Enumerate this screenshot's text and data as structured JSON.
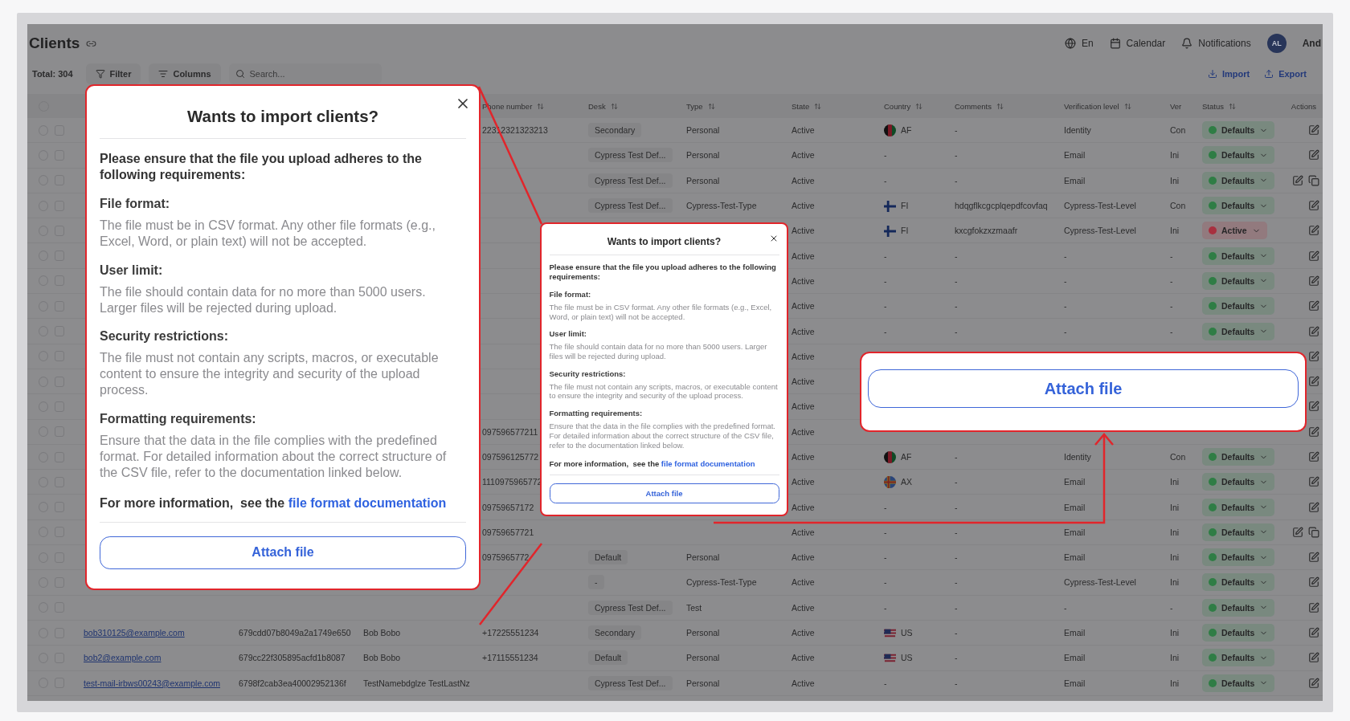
{
  "app": {
    "title": "Clients",
    "header_actions": [
      {
        "label": "En"
      },
      {
        "label": "Calendar"
      },
      {
        "label": "Notifications"
      }
    ],
    "user": {
      "initials": "AL",
      "name": "And"
    },
    "toolbar": {
      "total": "Total: 304",
      "buttons": [
        {
          "label": "Filter"
        },
        {
          "label": "Columns"
        }
      ],
      "search": {
        "placeholder": "Search..."
      },
      "actions": [
        {
          "label": "Import"
        },
        {
          "label": "Export"
        }
      ]
    },
    "table": {
      "columns": {
        "phone": {
          "label": "Phone number",
          "sortable": true
        },
        "desk": {
          "label": "Desk",
          "sortable": true
        },
        "type": {
          "label": "Type",
          "sortable": true
        },
        "state": {
          "label": "State",
          "sortable": true
        },
        "country": {
          "label": "Country",
          "sortable": true
        },
        "comments": {
          "label": "Comments",
          "sortable": true
        },
        "verification": {
          "label": "Verification level",
          "sortable": true
        },
        "ver": {
          "label": "Ver",
          "sortable": false
        },
        "status": {
          "label": "Status",
          "sortable": true
        },
        "actions": {
          "label": "Actions",
          "sortable": false
        }
      },
      "rows": [
        {
          "kind": "single",
          "checked": false,
          "phone": "22312321323213",
          "desk": "Secondary",
          "type": "Personal",
          "state": "Active",
          "country": {
            "code": "AF",
            "kind": "af"
          },
          "comments": "-",
          "verification": "Identity",
          "ver": "Con",
          "status": {
            "label": "Defaults",
            "color": "#2f7d45"
          }
        },
        {
          "kind": "single",
          "checked": false,
          "desk": "Cypress Test Def...",
          "type": "Personal",
          "state": "Active",
          "country": {
            "code": "-",
            "kind": "none"
          },
          "comments": "-",
          "verification": "Email",
          "ver": "Ini",
          "status": {
            "label": "Defaults",
            "color": "#2f7d45"
          }
        },
        {
          "kind": "double",
          "checked": false,
          "desk": "Cypress Test Def...",
          "type": "Personal",
          "state": "Active",
          "country": {
            "code": "-",
            "kind": "none"
          },
          "comments": "-",
          "verification": "Email",
          "ver": "Ini",
          "status": {
            "label": "Defaults",
            "color": "#2f7d45"
          }
        },
        {
          "kind": "single",
          "checked": false,
          "desk": "Cypress Test Def...",
          "type": "Cypress-Test-Type",
          "state": "Active",
          "country": {
            "code": "FI",
            "kind": "fi"
          },
          "comments": "hdqgflkcgcplqepdfcovfaq",
          "verification": "Cypress-Test-Level",
          "ver": "Con",
          "status": {
            "label": "Defaults",
            "color": "#2f7d45"
          }
        },
        {
          "kind": "single",
          "checked": false,
          "state": "Active",
          "country": {
            "code": "FI",
            "kind": "fi"
          },
          "comments": "kxcgfokzxzmaafr",
          "verification": "Cypress-Test-Level",
          "ver": "Ini",
          "status": {
            "label": "Active",
            "color": "#a8303f"
          }
        },
        {
          "kind": "single",
          "checked": false,
          "state": "Active",
          "country": {
            "code": "-",
            "kind": "none"
          },
          "comments": "-",
          "verification": "-",
          "ver": "-",
          "status": {
            "label": "Defaults",
            "color": "#2f7d45"
          }
        },
        {
          "kind": "single",
          "checked": false,
          "state": "Active",
          "country": {
            "code": "-",
            "kind": "none"
          },
          "comments": "-",
          "verification": "-",
          "ver": "-",
          "status": {
            "label": "Defaults",
            "color": "#2f7d45"
          }
        },
        {
          "kind": "single",
          "checked": false,
          "state": "Active",
          "country": {
            "code": "-",
            "kind": "none"
          },
          "comments": "-",
          "verification": "-",
          "ver": "-",
          "status": {
            "label": "Defaults",
            "color": "#2f7d45"
          }
        },
        {
          "kind": "single",
          "checked": false,
          "state": "Active",
          "country": {
            "code": "-",
            "kind": "none"
          },
          "comments": "-",
          "verification": "-",
          "ver": "-",
          "status": {
            "label": "Defaults",
            "color": "#2f7d45"
          }
        },
        {
          "kind": "single",
          "checked": false,
          "state": "Active"
        },
        {
          "kind": "single",
          "checked": false,
          "state": "Active"
        },
        {
          "kind": "single",
          "checked": false,
          "state": "Active"
        },
        {
          "kind": "single",
          "checked": false,
          "phone": "097596577211",
          "state": "Active"
        },
        {
          "kind": "single",
          "checked": false,
          "phone": "097596125772",
          "state": "Active",
          "country": {
            "code": "AF",
            "kind": "af"
          },
          "comments": "-",
          "verification": "Identity",
          "ver": "Con",
          "status": {
            "label": "Defaults",
            "color": "#2f7d45"
          }
        },
        {
          "kind": "single",
          "checked": false,
          "phone": "1110975965772",
          "state": "Active",
          "country": {
            "code": "AX",
            "kind": "ax"
          },
          "comments": "-",
          "verification": "Email",
          "ver": "Ini",
          "status": {
            "label": "Defaults",
            "color": "#2f7d45"
          }
        },
        {
          "kind": "single",
          "checked": false,
          "phone": "09759657172",
          "state": "Active",
          "country": {
            "code": "-",
            "kind": "none"
          },
          "comments": "-",
          "verification": "Email",
          "ver": "Ini",
          "status": {
            "label": "Defaults",
            "color": "#2f7d45"
          }
        },
        {
          "kind": "double",
          "checked": false,
          "phone": "09759657721",
          "state": "Active",
          "country": {
            "code": "-",
            "kind": "none"
          },
          "comments": "-",
          "verification": "Email",
          "ver": "Ini",
          "status": {
            "label": "Defaults",
            "color": "#2f7d45"
          }
        },
        {
          "kind": "single",
          "checked": false,
          "phone": "0975965772",
          "desk": "Default",
          "type": "Personal",
          "state": "Active",
          "country": {
            "code": "-",
            "kind": "none"
          },
          "comments": "-",
          "verification": "Email",
          "ver": "Ini",
          "status": {
            "label": "Defaults",
            "color": "#2f7d45"
          }
        },
        {
          "kind": "single",
          "checked": false,
          "desk": "-",
          "type": "Cypress-Test-Type",
          "state": "Active",
          "country": {
            "code": "-",
            "kind": "none"
          },
          "comments": "-",
          "verification": "Cypress-Test-Level",
          "ver": "Ini",
          "status": {
            "label": "Defaults",
            "color": "#2f7d45"
          }
        },
        {
          "kind": "single",
          "checked": false,
          "desk": "Cypress Test Def...",
          "type": "Test",
          "state": "Active",
          "country": {
            "code": "-",
            "kind": "none"
          },
          "comments": "-",
          "verification": "-",
          "ver": "-",
          "status": {
            "label": "Defaults",
            "color": "#2f7d45"
          }
        },
        {
          "kind": "single",
          "checked": false,
          "email": "bob310125@example.com",
          "id": "679cdd07b8049a2a1749e650",
          "name": "Bob Bobo",
          "phone": "+17225551234",
          "desk": "Secondary",
          "type": "Personal",
          "state": "Active",
          "country": {
            "code": "US",
            "kind": "us"
          },
          "comments": "-",
          "verification": "Email",
          "ver": "Ini",
          "status": {
            "label": "Defaults",
            "color": "#2f7d45"
          }
        },
        {
          "kind": "single",
          "checked": false,
          "email": "bob2@example.com",
          "id": "679cc22f305895acfd1b8087",
          "name": "Bob Bobo",
          "phone": "+17115551234",
          "desk": "Default",
          "type": "Personal",
          "state": "Active",
          "country": {
            "code": "US",
            "kind": "us"
          },
          "comments": "-",
          "verification": "Email",
          "ver": "Ini",
          "status": {
            "label": "Defaults",
            "color": "#2f7d45"
          }
        },
        {
          "kind": "single",
          "checked": false,
          "email": "test-mail-irbws00243@example.com",
          "id": "6798f2cab3ea40002952136f",
          "name": "TestNamebdglze TestLastNz",
          "desk": "Cypress Test Def...",
          "type": "Personal",
          "state": "Active",
          "country": {
            "code": "-",
            "kind": "none"
          },
          "comments": "-",
          "verification": "Email",
          "ver": "Ini",
          "status": {
            "label": "Defaults",
            "color": "#2f7d45"
          }
        }
      ]
    }
  },
  "import_dialog": {
    "title": "Wants to import clients?",
    "intro": "Please ensure that the file you upload adheres to the following requirements:",
    "sections": [
      {
        "heading": "File format:",
        "text": "The file must be in CSV format. Any other file formats (e.g., Excel, Word, or plain text) will not be accepted."
      },
      {
        "heading": "User limit:",
        "text": "The file should contain data for no more than 5000 users. Larger files will be rejected during upload."
      },
      {
        "heading": "Security restrictions:",
        "text": "The file must not contain any scripts, macros, or executable content to ensure the integrity and security of the upload process."
      },
      {
        "heading": "Formatting requirements:",
        "text": "Ensure that the data in the file complies with the predefined format. For detailed information about the correct structure of the CSV file, refer to the documentation linked below."
      }
    ],
    "more_info": {
      "prefix": "For more information,  see the",
      "link": "file format documentation"
    },
    "button": "Attach file"
  },
  "magnified_dialog": {
    "title": "Wants to import clients?",
    "intro": "Please ensure that the file you upload adheres to the following requirements:",
    "sections": [
      {
        "heading": "File format:",
        "text": "The file must be in CSV format. Any other file formats (e.g., Excel, Word, or plain text) will not be accepted."
      },
      {
        "heading": "User limit:",
        "text": "The file should contain data for no more than 5000 users. Larger files will be rejected during upload."
      },
      {
        "heading": "Security restrictions:",
        "text": "The file must not contain any scripts, macros, or executable content to ensure the integrity and security of the upload process."
      },
      {
        "heading": "Formatting requirements:",
        "text": "Ensure that the data in the file complies with the predefined format. For detailed information about the correct structure of the CSV file, refer to the documentation linked below."
      }
    ],
    "more_info": {
      "prefix": "For more information,  see the",
      "link": "file format documentation"
    },
    "button": "Attach file"
  },
  "magnified_button": {
    "label": "Attach file"
  }
}
